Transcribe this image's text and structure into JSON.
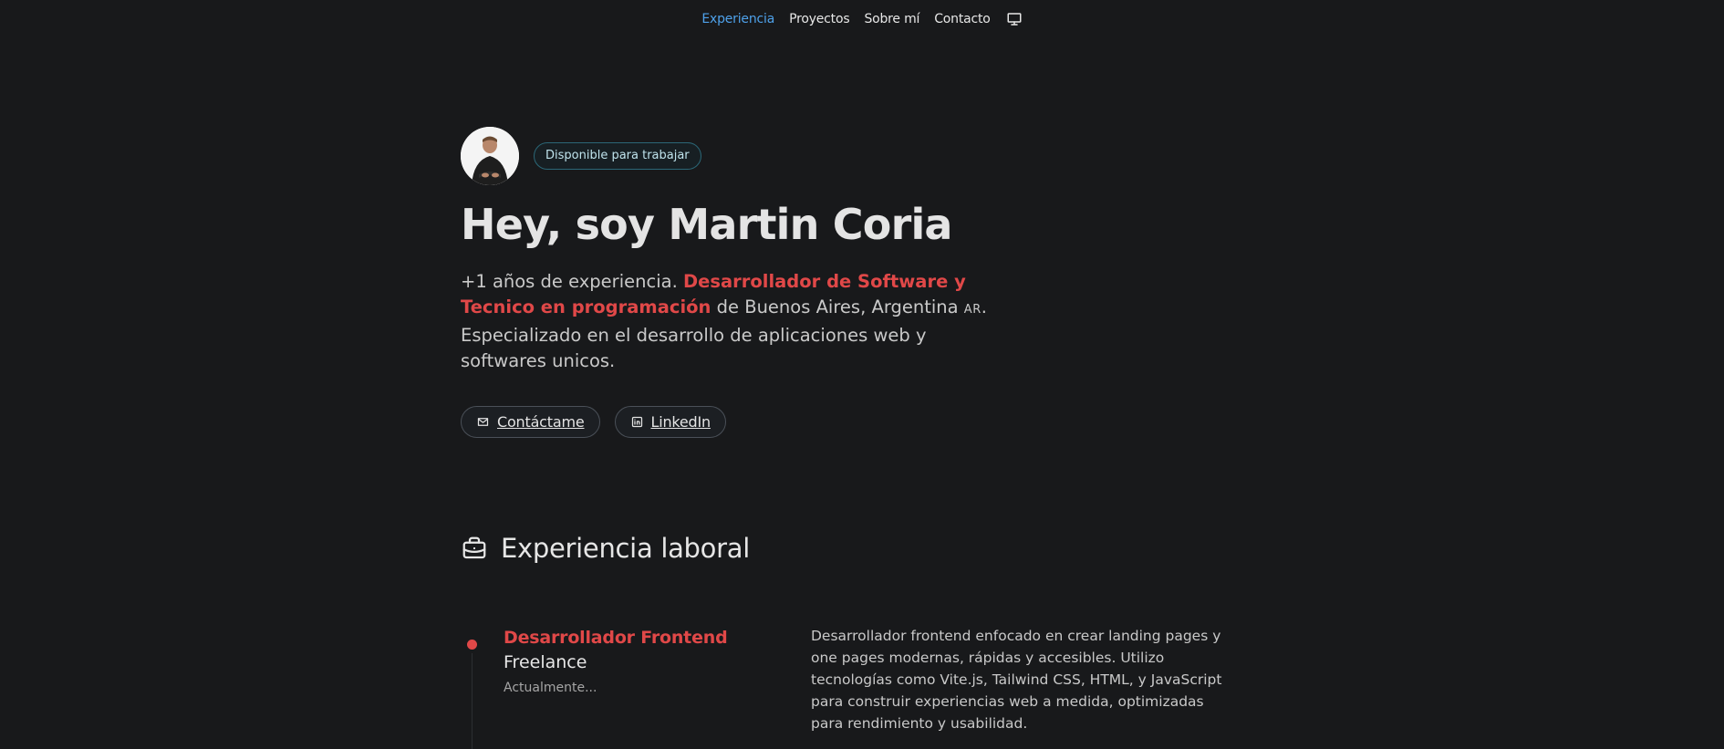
{
  "nav": {
    "items": [
      {
        "label": "Experiencia",
        "active": true
      },
      {
        "label": "Proyectos",
        "active": false
      },
      {
        "label": "Sobre mí",
        "active": false
      },
      {
        "label": "Contacto",
        "active": false
      }
    ],
    "theme_icon": "monitor-icon"
  },
  "hero": {
    "badge": "Disponible para trabajar",
    "title": "Hey, soy Martin Coria",
    "desc_part1": "+1 años de experiencia. ",
    "desc_highlight": "Desarrollador de Software y Tecnico en programación",
    "desc_part2": " de Buenos Aires, Argentina ",
    "desc_flag": "AR",
    "desc_part3": ". Especializado en el desarrollo de aplicaciones web y softwares unicos.",
    "contact_label": "Contáctame",
    "linkedin_label": "LinkedIn"
  },
  "experience": {
    "heading": "Experiencia laboral",
    "jobs": [
      {
        "title": "Desarrollador Frontend",
        "company": "Freelance",
        "date": "Actualmente...",
        "description": "Desarrollador frontend enfocado en crear landing pages y one pages modernas, rápidas y accesibles. Utilizo tecnologías como Vite.js, Tailwind CSS, HTML, y JavaScript para construir experiencias web a medida, optimizadas para rendimiento y usabilidad."
      }
    ]
  },
  "colors": {
    "background": "#18191b",
    "accent_red": "#e04848",
    "nav_active": "#4ea1ea",
    "badge_border": "#2b6777"
  }
}
